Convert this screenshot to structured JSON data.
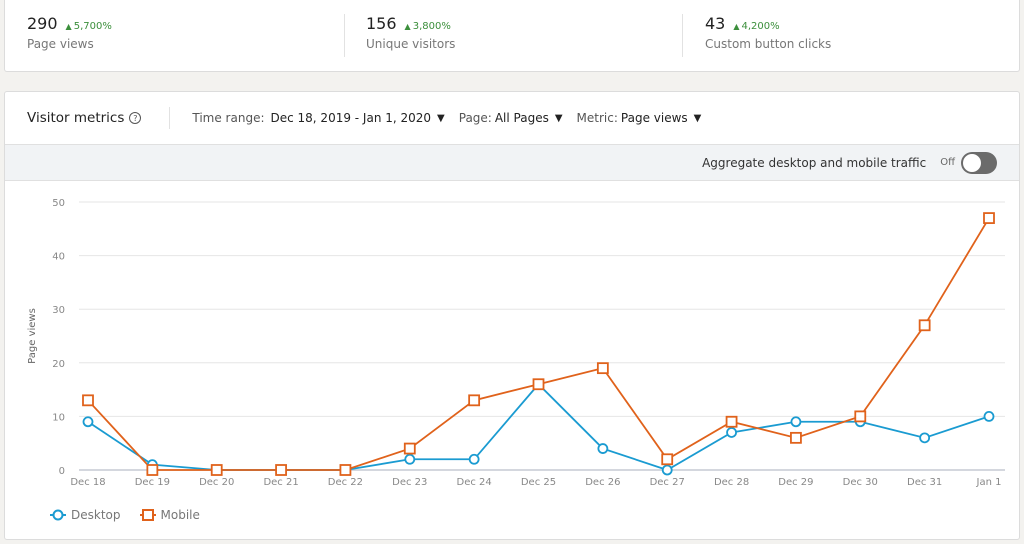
{
  "stats": [
    {
      "value": "290",
      "delta": "5,700%",
      "label": "Page views"
    },
    {
      "value": "156",
      "delta": "3,800%",
      "label": "Unique visitors"
    },
    {
      "value": "43",
      "delta": "4,200%",
      "label": "Custom button clicks"
    }
  ],
  "metrics": {
    "title": "Visitor metrics",
    "help_icon": "question-circle-icon",
    "filters": {
      "time_range": {
        "label": "Time range:",
        "value": "Dec 18, 2019 - Jan 1, 2020"
      },
      "page": {
        "label": "Page:",
        "value": "All Pages"
      },
      "metric": {
        "label": "Metric:",
        "value": "Page views"
      }
    },
    "aggregate": {
      "label": "Aggregate desktop and mobile traffic",
      "state": "Off",
      "enabled": false
    }
  },
  "colors": {
    "desktop": "#1a9bd1",
    "mobile": "#e0621b",
    "delta_up": "#3c8f3c"
  },
  "chart_data": {
    "type": "line",
    "title": "",
    "xlabel": "",
    "ylabel": "Page views",
    "ylim": [
      0,
      50
    ],
    "yticks": [
      0,
      10,
      20,
      30,
      40,
      50
    ],
    "grid": true,
    "legend": "bottom-left",
    "categories": [
      "Dec 18",
      "Dec 19",
      "Dec 20",
      "Dec 21",
      "Dec 22",
      "Dec 23",
      "Dec 24",
      "Dec 25",
      "Dec 26",
      "Dec 27",
      "Dec 28",
      "Dec 29",
      "Dec 30",
      "Dec 31",
      "Jan 1"
    ],
    "series": [
      {
        "name": "Desktop",
        "marker": "circle",
        "values": [
          9,
          1,
          0,
          0,
          0,
          2,
          2,
          16,
          4,
          0,
          7,
          9,
          9,
          6,
          10
        ]
      },
      {
        "name": "Mobile",
        "marker": "square",
        "values": [
          13,
          0,
          0,
          0,
          0,
          4,
          13,
          16,
          19,
          2,
          9,
          6,
          10,
          27,
          47
        ]
      }
    ]
  }
}
